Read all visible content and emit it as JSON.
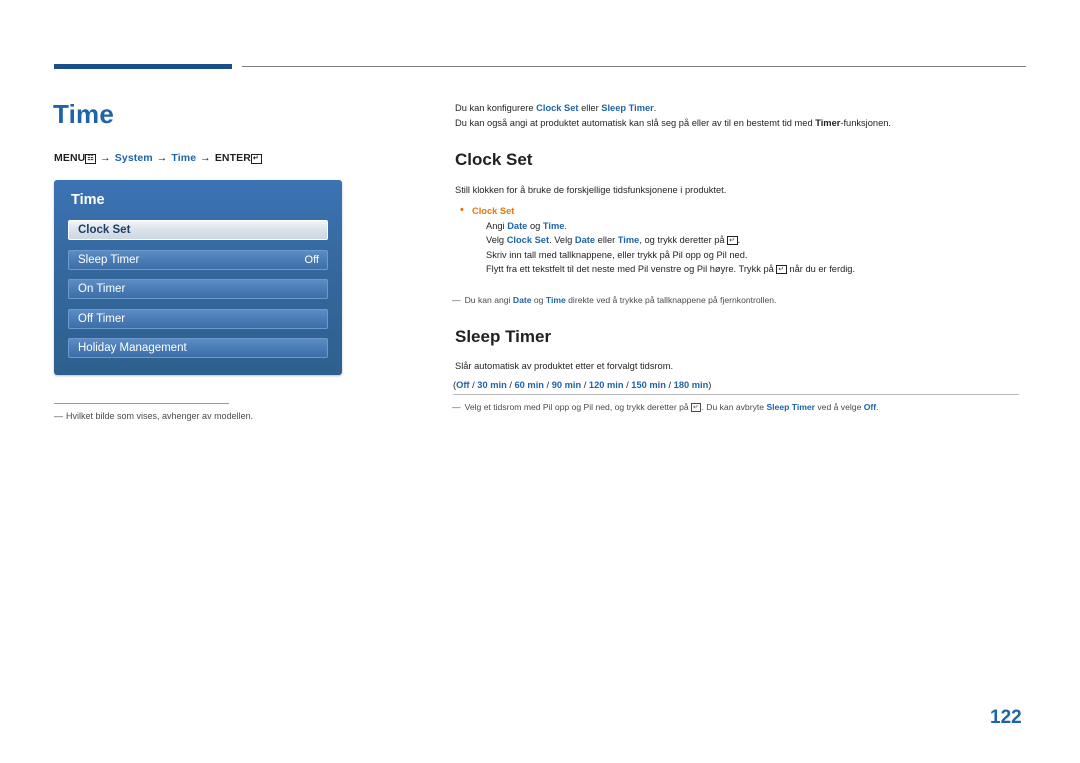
{
  "page": {
    "title": "Time",
    "number": "122"
  },
  "menu_path": {
    "menu_label": "MENU",
    "menu_glyph": "m",
    "arrow": "→",
    "system": "System",
    "time": "Time",
    "enter_label": "ENTER",
    "enter_glyph": "↵"
  },
  "osd": {
    "title": "Time",
    "items": [
      {
        "label": "Clock Set",
        "value": "",
        "selected": true
      },
      {
        "label": "Sleep Timer",
        "value": "Off",
        "selected": false
      },
      {
        "label": "On Timer",
        "value": "",
        "selected": false
      },
      {
        "label": "Off Timer",
        "value": "",
        "selected": false
      },
      {
        "label": "Holiday Management",
        "value": "",
        "selected": false
      }
    ]
  },
  "left_note": {
    "dash": "―",
    "text": "Hvilket bilde som vises, avhenger av modellen."
  },
  "intro": {
    "line1_a": "Du kan konfigurere ",
    "line1_b": "Clock Set",
    "line1_c": " eller ",
    "line1_d": "Sleep Timer",
    "line1_e": ".",
    "line2_a": "Du kan også angi at produktet automatisk kan slå seg på eller av til en bestemt tid med ",
    "line2_b": "Timer",
    "line2_c": "-funksjonen."
  },
  "clock_set": {
    "heading": "Clock Set",
    "paragraph": "Still klokken for å bruke de forskjellige tidsfunksjonene i produktet.",
    "bullet_title": "Clock Set",
    "lines": [
      {
        "parts": [
          {
            "t": "Angi ",
            "s": "n"
          },
          {
            "t": "Date",
            "s": "b"
          },
          {
            "t": " og ",
            "s": "n"
          },
          {
            "t": "Time",
            "s": "b"
          },
          {
            "t": ".",
            "s": "n"
          }
        ]
      },
      {
        "parts": [
          {
            "t": "Velg ",
            "s": "n"
          },
          {
            "t": "Clock Set",
            "s": "b"
          },
          {
            "t": ". Velg ",
            "s": "n"
          },
          {
            "t": "Date",
            "s": "b"
          },
          {
            "t": " eller ",
            "s": "n"
          },
          {
            "t": "Time",
            "s": "b"
          },
          {
            "t": ", og trykk deretter på ",
            "s": "n"
          },
          {
            "t": "ENTER",
            "s": "e"
          },
          {
            "t": ".",
            "s": "n"
          }
        ]
      },
      {
        "parts": [
          {
            "t": "Skriv inn tall med tallknappene, eller trykk på Pil opp og Pil ned.",
            "s": "n"
          }
        ]
      },
      {
        "parts": [
          {
            "t": "Flytt fra ett tekstfelt til det neste med Pil venstre og Pil høyre. Trykk på ",
            "s": "n"
          },
          {
            "t": "ENTER",
            "s": "e"
          },
          {
            "t": " når du er ferdig.",
            "s": "n"
          }
        ]
      }
    ],
    "note": {
      "dash": "―",
      "a": "Du kan angi ",
      "b": "Date",
      "c": " og ",
      "d": "Time",
      "e": " direkte ved å trykke på tallknappene på fjernkontrollen."
    }
  },
  "sleep_timer": {
    "heading": "Sleep Timer",
    "paragraph": "Slår automatisk av produktet etter et forvalgt tidsrom.",
    "options_prefix": "(",
    "options": [
      "Off",
      "30 min",
      "60 min",
      "90 min",
      "120 min",
      "150 min",
      "180 min"
    ],
    "options_separator": " / ",
    "options_suffix": ")",
    "note": {
      "dash": "―",
      "a": "Velg et tidsrom med Pil opp og Pil ned, og trykk deretter på ",
      "enter": "ENTER",
      "b": ". Du kan avbryte ",
      "c": "Sleep Timer",
      "d": " ved å velge ",
      "e": "Off",
      "f": "."
    }
  },
  "colors": {
    "accent_blue": "#1f63a8",
    "bullet_orange": "#e87511",
    "osd_blue": "#3c73b4"
  }
}
